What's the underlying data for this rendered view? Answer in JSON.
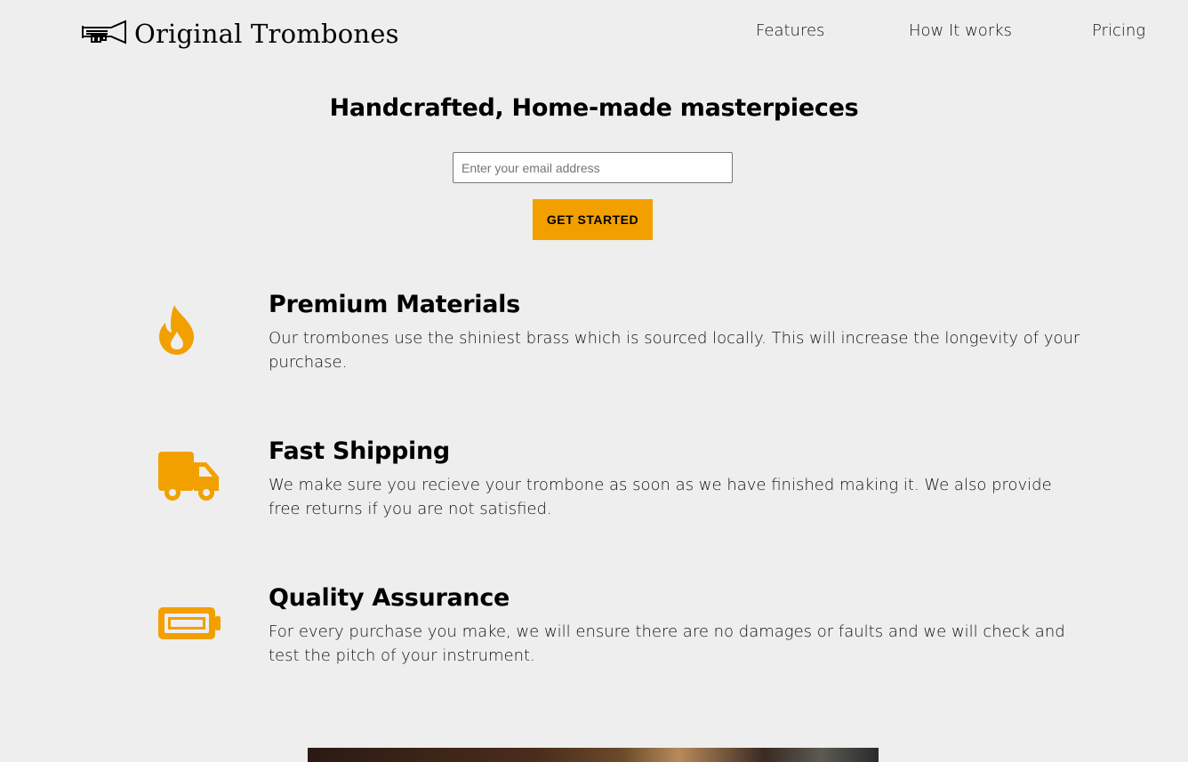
{
  "header": {
    "logo_text": "Original Trombones",
    "logo_icon": "trombone-icon",
    "nav": [
      {
        "label": "Features"
      },
      {
        "label": "How It works"
      },
      {
        "label": "Pricing"
      }
    ]
  },
  "hero": {
    "title": "Handcrafted, Home-made masterpieces",
    "email_placeholder": "Enter your email address",
    "email_value": "",
    "cta_label": "GET STARTED"
  },
  "features": [
    {
      "icon": "fire-icon",
      "title": "Premium Materials",
      "text": "Our trombones use the shiniest brass which is sourced locally. This will increase the longevity of your purchase."
    },
    {
      "icon": "truck-icon",
      "title": "Fast Shipping",
      "text": "We make sure you recieve your trombone as soon as we have finished making it. We also provide free returns if you are not satisfied."
    },
    {
      "icon": "battery-icon",
      "title": "Quality Assurance",
      "text": "For every purchase you make, we will ensure there are no damages or faults and we will check and test the pitch of your instrument."
    }
  ],
  "colors": {
    "accent": "#f1a000",
    "background": "#eeeeee",
    "text": "#000000"
  }
}
